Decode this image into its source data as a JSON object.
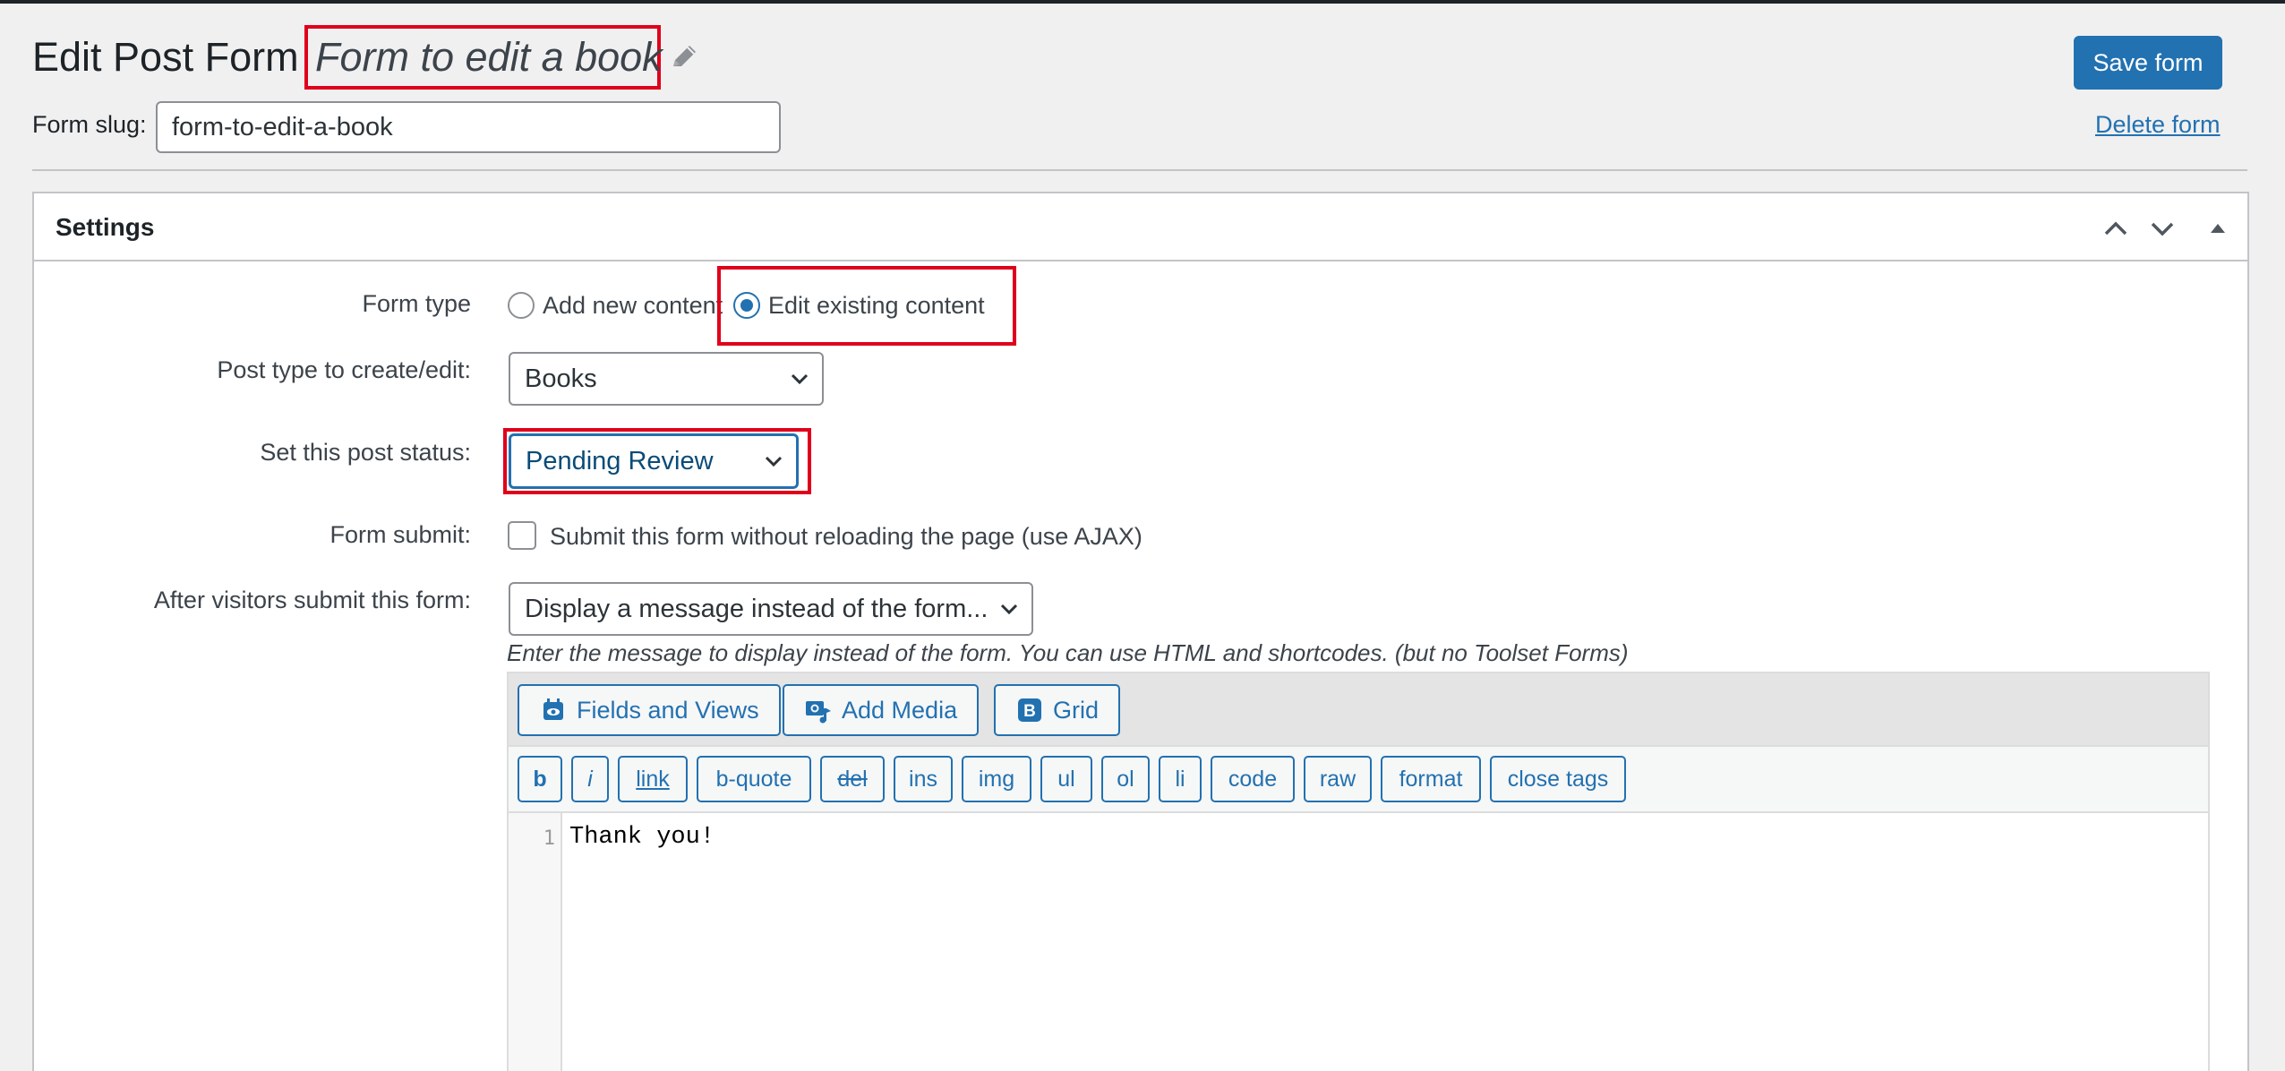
{
  "header": {
    "page_title": "Edit Post Form",
    "form_name": "Form to edit a book",
    "save_label": "Save form",
    "delete_label": "Delete form",
    "slug_label": "Form slug:",
    "slug_value": "form-to-edit-a-book"
  },
  "settings": {
    "title": "Settings",
    "form_type": {
      "label": "Form type",
      "options": [
        "Add new content",
        "Edit existing content"
      ],
      "selected": "Edit existing content"
    },
    "post_type": {
      "label": "Post type to create/edit:",
      "value": "Books"
    },
    "post_status": {
      "label": "Set this post status:",
      "value": "Pending Review"
    },
    "form_submit": {
      "label": "Form submit:",
      "checkbox_label": "Submit this form without reloading the page (use AJAX)",
      "checked": false
    },
    "after_submit": {
      "label": "After visitors submit this form:",
      "value": "Display a message instead of the form...",
      "hint": "Enter the message to display instead of the form. You can use HTML and shortcodes. (but no Toolset Forms)"
    }
  },
  "editor": {
    "toolbar": [
      {
        "label": "Fields and Views",
        "icon": "fields-views-icon"
      },
      {
        "label": "Add Media",
        "icon": "add-media-icon"
      },
      {
        "label": "Grid",
        "icon": "grid-icon"
      }
    ],
    "quicktags": [
      "b",
      "i",
      "link",
      "b-quote",
      "del",
      "ins",
      "img",
      "ul",
      "ol",
      "li",
      "code",
      "raw",
      "format",
      "close tags"
    ],
    "line_numbers": [
      "1"
    ],
    "content": "Thank you!"
  },
  "colors": {
    "accent": "#2271b1",
    "highlight_box": "#e0001b",
    "background": "#f0f0f1"
  }
}
